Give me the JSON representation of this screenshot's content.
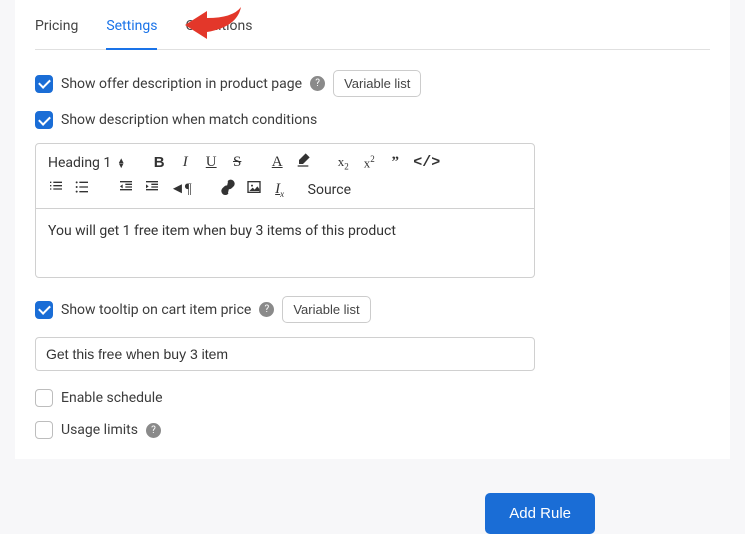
{
  "tabs": {
    "pricing": "Pricing",
    "settings": "Settings",
    "conditions": "Conditions"
  },
  "offerDesc": {
    "label": "Show offer description in product page",
    "varBtn": "Variable list"
  },
  "matchCond": {
    "label": "Show description when match conditions"
  },
  "editor": {
    "heading": "Heading 1",
    "source": "Source",
    "content": "You will get 1 free item when buy 3 items of this product"
  },
  "tooltip": {
    "label": "Show tooltip on cart item price",
    "varBtn": "Variable list",
    "value": "Get this free when buy 3 item"
  },
  "schedule": {
    "label": "Enable schedule"
  },
  "limits": {
    "label": "Usage limits"
  },
  "addRule": "Add Rule"
}
